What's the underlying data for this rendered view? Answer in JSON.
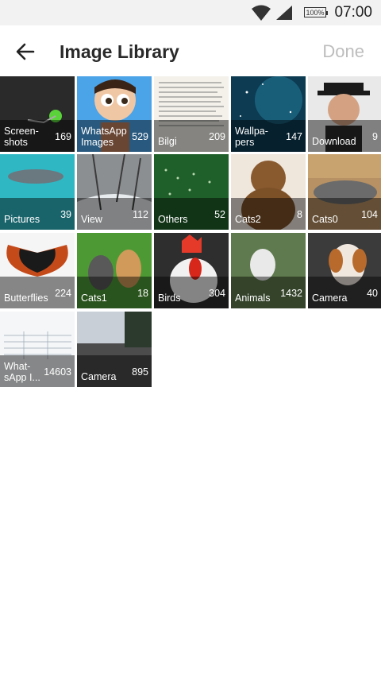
{
  "status_bar": {
    "time": "07:00",
    "battery": "100%"
  },
  "header": {
    "title": "Image Library",
    "done_label": "Done"
  },
  "albums": [
    {
      "name": "Screen-\nshots",
      "count": "169"
    },
    {
      "name": "WhatsApp\nImages",
      "count": "529"
    },
    {
      "name": "Bilgi",
      "count": "209"
    },
    {
      "name": "Wallpa-\npers",
      "count": "147"
    },
    {
      "name": "Download",
      "count": "9"
    },
    {
      "name": "Pictures",
      "count": "39"
    },
    {
      "name": "View",
      "count": "112"
    },
    {
      "name": "Others",
      "count": "52"
    },
    {
      "name": "Cats2",
      "count": "8"
    },
    {
      "name": "Cats0",
      "count": "104"
    },
    {
      "name": "Butterflies",
      "count": "224"
    },
    {
      "name": "Cats1",
      "count": "18"
    },
    {
      "name": "Birds",
      "count": "304"
    },
    {
      "name": "Animals",
      "count": "1432"
    },
    {
      "name": "Camera",
      "count": "40"
    },
    {
      "name": "What-\nsApp I...",
      "count": "14603"
    },
    {
      "name": "Camera",
      "count": "895"
    }
  ]
}
